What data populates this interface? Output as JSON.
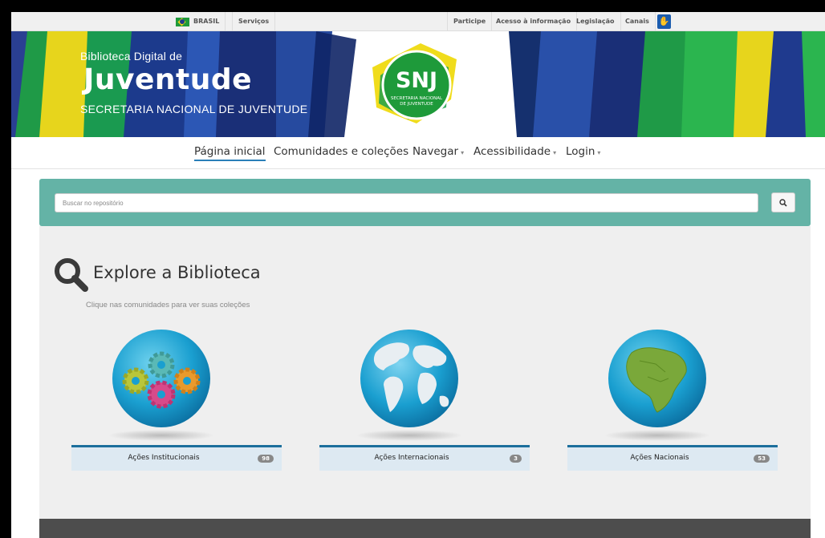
{
  "govbar": {
    "brasil": "BRASIL",
    "servicos": "Serviços",
    "participe": "Participe",
    "acesso": "Acesso à informação",
    "legislacao": "Legislação",
    "canais": "Canais"
  },
  "banner": {
    "subtitle": "Biblioteca Digital de",
    "title": "Juventude",
    "org": "SECRETARIA NACIONAL DE JUVENTUDE",
    "logo_text": "SNJ",
    "logo_sub1": "SECRETARIA NACIONAL",
    "logo_sub2": "DE JUVENTUDE"
  },
  "nav": {
    "home": "Página inicial",
    "communities": "Comunidades e coleções",
    "browse": "Navegar",
    "accessibility": "Acessibilidade",
    "login": "Login"
  },
  "search": {
    "placeholder": "Buscar no repositório"
  },
  "explore": {
    "title": "Explore a Biblioteca",
    "subtitle": "Clique nas comunidades para ver suas coleções"
  },
  "communities": [
    {
      "label": "Ações Institucionais",
      "count": "98",
      "icon": "gears-globe-icon"
    },
    {
      "label": "Ações Internacionais",
      "count": "3",
      "icon": "world-globe-icon"
    },
    {
      "label": "Ações Nacionais",
      "count": "53",
      "icon": "brazil-globe-icon"
    }
  ],
  "colors": {
    "search_panel": "#64b3a6",
    "accent_blue": "#1c6f9c",
    "brazil_green": "#1e9a3a",
    "brazil_yellow": "#f4d21a",
    "brazil_blue": "#1c3c8a"
  }
}
